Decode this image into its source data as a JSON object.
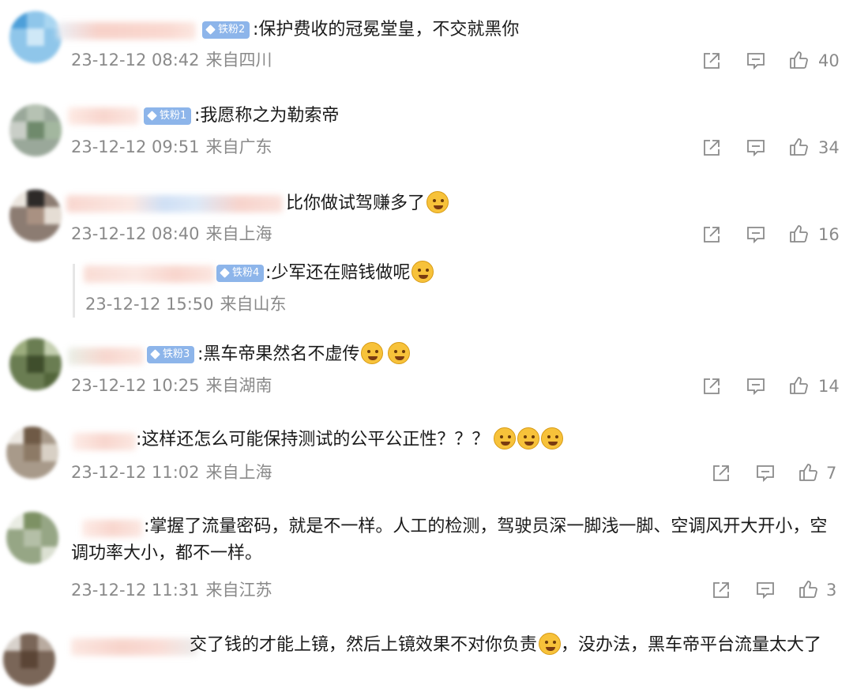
{
  "comments": [
    {
      "badge": "铁粉2",
      "text": ":保护费收的冠冕堂皇，不交就黑你",
      "emojis": [],
      "time": "23-12-12 08:42",
      "location": "来自四川",
      "likes": "40"
    },
    {
      "badge": "铁粉1",
      "text": ":我愿称之为勒索帝",
      "emojis": [],
      "time": "23-12-12 09:51",
      "location": "来自广东",
      "likes": "34"
    },
    {
      "badge": "",
      "text": "比你做试驾赚多了",
      "emojis": [
        "laugh-cry"
      ],
      "time": "23-12-12 08:40",
      "location": "来自上海",
      "likes": "16"
    },
    {
      "reply": true,
      "badge": "铁粉4",
      "text": ":少军还在赔钱做呢",
      "emojis": [
        "smirk"
      ],
      "time": "23-12-12 15:50",
      "location": "来自山东"
    },
    {
      "badge": "铁粉3",
      "text": ":黑车帝果然名不虚传",
      "emojis": [
        "hug",
        "hug"
      ],
      "time": "23-12-12 10:25",
      "location": "来自湖南",
      "likes": "14"
    },
    {
      "badge": "",
      "text": ":这样还怎么可能保持测试的公平公正性？？？",
      "emojis": [
        "sweat",
        "sweat",
        "sweat"
      ],
      "time": "23-12-12 11:02",
      "location": "来自上海",
      "likes": "7"
    },
    {
      "badge": "",
      "text": ":掌握了流量密码，就是不一样。人工的检测，驾驶员深一脚浅一脚、空调风开大开小，空调功率大小，都不一样。",
      "emojis": [],
      "time": "23-12-12 11:31",
      "location": "来自江苏",
      "likes": "3"
    },
    {
      "badge": "",
      "text": "交了钱的才能上镜，然后上镜效果不对你负责",
      "text_after_emoji": "，没办法，黑车帝平台流量太大了",
      "emojis": [
        "laugh-cry"
      ],
      "time": "",
      "location": ""
    }
  ],
  "icons": {
    "share": "share-icon",
    "comment": "comment-icon",
    "like": "thumbs-up-icon"
  },
  "colors": {
    "badge": "#8db5ea",
    "meta": "#8a8a8a",
    "text": "#1a1a1a"
  }
}
